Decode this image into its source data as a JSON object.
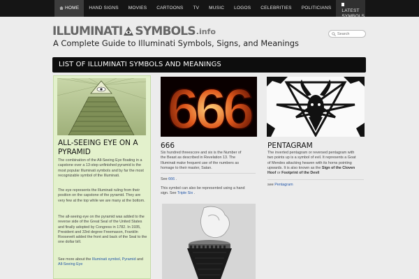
{
  "nav": {
    "home": "HOME",
    "items": [
      "HAND SIGNS",
      "MOVIES",
      "CARTOONS",
      "TV",
      "MUSIC",
      "LOGOS",
      "CELEBRITIES",
      "POLITICIANS"
    ],
    "latest": "LATEST SYMBOLS"
  },
  "header": {
    "logo_left": "ILLUMINATI",
    "logo_right": "SYMBOLS",
    "logo_tld": ".info",
    "tagline": "A Complete Guide to Illuminati Symbols, Signs, and Meanings",
    "search_placeholder": "Search"
  },
  "main": {
    "title": "LIST OF ILLUMINATI SYMBOLS AND MEANINGS"
  },
  "featured": {
    "title": "ALL-SEEING EYE ON A PYRAMID",
    "p1": "The combination of the All-Seeing Eye floating in a capstone over a 13-step unfinished pyramid is the most popular Illuminati symbols and by far the most recognizable symbol of the Illuminati.",
    "p2": "The eye represents the Illuminati ruling from their position on the capstone of the pyramid. They are very few at the top while we are many at the bottom.",
    "p3": "The all-seeing eye on the pyramid was added to the reverse side of the Great Seal of the United States and finally adopted by Congress in 1782. In 1935, President and 33rd degree Freemason, Franklin Roosevelt added the front and back of the Seal to the one dollar bill.",
    "see_more": "See more about the",
    "link1": "Illuminati symbol",
    "comma": ",",
    "link2": "Pyramid",
    "and": "and",
    "link3": "All-Seeing Eye"
  },
  "card666": {
    "image_text": "666",
    "title": "666",
    "p1": "Six hundred threescore and six is the Number of the Beast as described in Revelation 13. The Illuminati make frequent use of the numbers as homage to their master, Satan.",
    "see": "See",
    "see_link": "666",
    "dot": ".",
    "p2": "This symbol can also be represented using a hand sign. See",
    "p2_link": "Triple Six",
    "dot2": "."
  },
  "pentagram": {
    "title": "PENTAGRAM",
    "p1": "The inverted pentagram or reversed pentagram with two points up is a symbol of evil.",
    "p1b": "It represents a Goat of Mendes attacking heaven with its horns pointing upwards. It is also known as the",
    "tag1": "Sign of the Cloven Hoof",
    "or": "or",
    "tag2": "Footprint of the Devil",
    "see": "see",
    "see_link": "Pentagram"
  }
}
